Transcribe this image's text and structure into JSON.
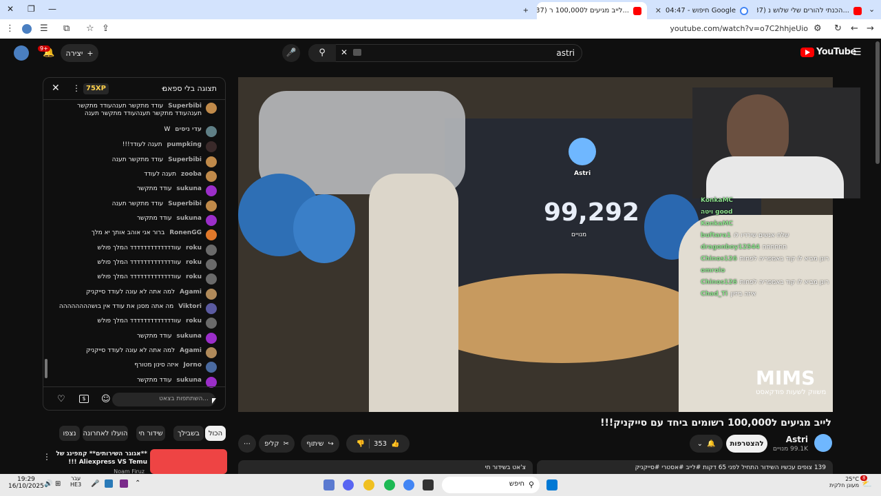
{
  "tabs": [
    {
      "title": "(37) הכנתי להורים שלי שלוש נ...",
      "active": false
    },
    {
      "title": "04:47 - חיפוש Google",
      "active": false
    },
    {
      "title": "(37) לייב מגיעים ל100,000 ר...",
      "active": true
    }
  ],
  "address": {
    "url": "youtube.com/watch?v=o7C2hhjeUio"
  },
  "header": {
    "search_query": "astri",
    "create_label": "יצירה",
    "notif_count": "9+",
    "logo_text": "YouTube"
  },
  "chat": {
    "mode": "תצוגה בלי ספאם",
    "xp": "75XP",
    "input_placeholder": "השתתפות בצאט...",
    "messages": [
      {
        "author": "Superbibi",
        "text": "עודד מתקשר תענהעודד מתקשר תענהעודד מתקשר תענהעודד מתקשר תענה",
        "color": "#c08a4a"
      },
      {
        "author": "עדי ניסים",
        "text": "W",
        "color": "#5f7f86"
      },
      {
        "author": "pumpking",
        "text": "תענה לעודד!!!",
        "color": "#3a2a2a"
      },
      {
        "author": "Superbibi",
        "text": "עודד מתקשר תענה",
        "color": "#c08a4a"
      },
      {
        "author": "zooba",
        "text": "תענה לעודד",
        "color": "#c08a4a"
      },
      {
        "author": "sukuna",
        "text": "עודד מתקשר",
        "color": "#9b2ec9"
      },
      {
        "author": "Superbibi",
        "text": "עודד מתקשר תענה",
        "color": "#c08a4a"
      },
      {
        "author": "sukuna",
        "text": "עודד מתקשר",
        "color": "#9b2ec9"
      },
      {
        "author": "RonenGG",
        "text": "ברור אני אוהב אותך יא מלך",
        "color": "#e0782a"
      },
      {
        "author": "roku",
        "text": "עוודדדדדדדדדדדדד המלך פולש",
        "color": "#6a6a6a"
      },
      {
        "author": "roku",
        "text": "עוודדדדדדדדדדדדד המלך פולש",
        "color": "#6a6a6a"
      },
      {
        "author": "roku",
        "text": "עוודדדדדדדדדדדדד המלך פולש",
        "color": "#6a6a6a"
      },
      {
        "author": "Agami",
        "text": "למה אתה לא עונה לעודד סייקניק",
        "color": "#b08a5a"
      },
      {
        "author": "Viktori",
        "text": "מה אתה מסנן את עודד אין בושהההההההה",
        "color": "#5a5aa0"
      },
      {
        "author": "roku",
        "text": "עוודדדדדדדדדדדדד המלך פולש",
        "color": "#6a6a6a"
      },
      {
        "author": "sukuna",
        "text": "עודד מתקשר",
        "color": "#9b2ec9"
      },
      {
        "author": "Agami",
        "text": "למה אתה לא עונה לעודד סייקניק",
        "color": "#b08a5a"
      },
      {
        "author": "Jorno",
        "text": "איזה סינון מטורף",
        "color": "#4a6aa0"
      },
      {
        "author": "sukuna",
        "text": "עודד מתקשר",
        "color": "#9b2ec9"
      }
    ]
  },
  "chips": [
    "הכול",
    "בשבילך",
    "שידור חי",
    "הועלו לאחרונה",
    "נצפו"
  ],
  "video": {
    "title": "לייב מגיעים ל100,000 רשומים ביחד עם סייקניק!!!",
    "overlay_name": "Astri",
    "overlay_count": "99,292",
    "overlay_count_label": "מנויים",
    "brand": "MIMS",
    "brand_sub": "משווק לשעות פודקאסט",
    "chat_overlay": [
      {
        "name": "KonkaMC",
        "text": ""
      },
      {
        "name": "ויטה good",
        "text": ""
      },
      {
        "name": "KonkaMC",
        "text": ""
      },
      {
        "name": "buftara1",
        "text": "שלח אנשים שירדיו לו"
      },
      {
        "name": "dragonboy12544",
        "text": "חחחחחח"
      },
      {
        "name": "Chinos126",
        "text": "רונן מביא לו קוד באמפריה לפחות"
      },
      {
        "name": "omrolo",
        "text": ""
      },
      {
        "name": "Chinos126",
        "text": "רונן מביא לו קוד באמפריה לפחות"
      },
      {
        "name": "Chad_Ti",
        "text": "איזה ביזיון"
      }
    ]
  },
  "channel": {
    "name": "Astri",
    "subs": "99.1K מנויים",
    "join_label": "להצטרפות"
  },
  "actions": {
    "likes": "353",
    "share": "שיתוף",
    "clip": "קליפ"
  },
  "description": {
    "stats": "139 צופים עכשיו השידור התחיל לפני 65 דקות #לייב #אסטרי #סייקניק",
    "chat_replay": "צ'אט בשידור חי"
  },
  "recommend": {
    "title": "**אגוגר השירותים** קמפינג של Aliexpress VS Temu !!!",
    "channel": "Noam Firuz"
  },
  "taskbar": {
    "time": "19:29",
    "date": "16/10/2025",
    "lang": "עבר",
    "lang2": "HE3",
    "search": "חיפש",
    "weather_temp": "25°C",
    "weather_desc": "מעונן חלקית",
    "notif": "8"
  }
}
